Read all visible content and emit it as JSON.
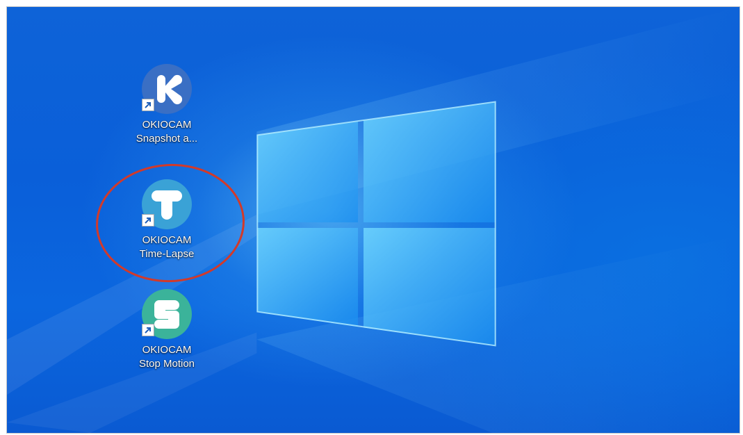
{
  "desktop": {
    "icons": [
      {
        "line1": "OKIOCAM",
        "line2": "Snapshot a...",
        "glyph": "K",
        "icon": "okiocam-snapshot-icon",
        "color": "#3a6fc4"
      },
      {
        "line1": "OKIOCAM",
        "line2": "Time-Lapse",
        "glyph": "T",
        "icon": "okiocam-timelapse-icon",
        "color": "#3aa2d6"
      },
      {
        "line1": "OKIOCAM",
        "line2": "Stop Motion",
        "glyph": "S",
        "icon": "okiocam-stopmotion-icon",
        "color": "#3bb39a"
      }
    ],
    "shortcut_overlay_icon": "shortcut-arrow-icon",
    "highlight_color": "#d23a2a"
  }
}
